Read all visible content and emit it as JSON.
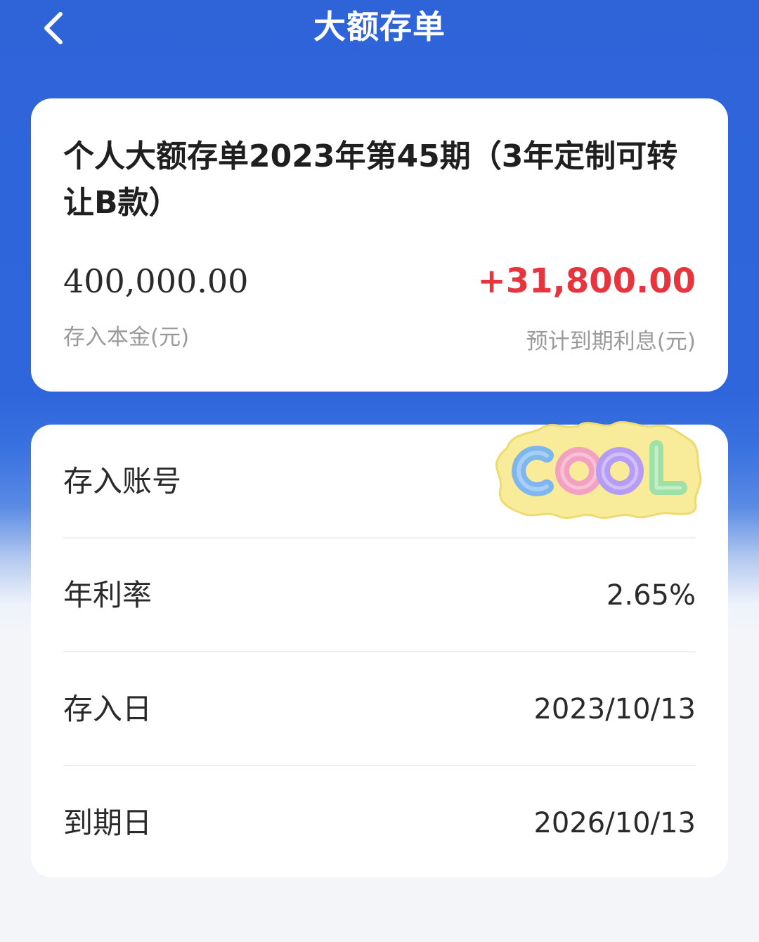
{
  "header": {
    "title": "大额存单",
    "back_icon": "chevron-left-icon"
  },
  "summary": {
    "product_name": "个人大额存单2023年第45期（3年定制可转让B款）",
    "principal": "400,000.00",
    "principal_label": "存入本金(元)",
    "interest": "+31,800.00",
    "interest_label": "预计到期利息(元)"
  },
  "details": {
    "account_label": "存入账号",
    "account_sticker": "COOL",
    "rate_label": "年利率",
    "rate_value": "2.65%",
    "start_label": "存入日",
    "start_value": "2023/10/13",
    "end_label": "到期日",
    "end_value": "2026/10/13"
  },
  "colors": {
    "brand_blue": "#2f64d9",
    "interest_red": "#e8343d"
  }
}
